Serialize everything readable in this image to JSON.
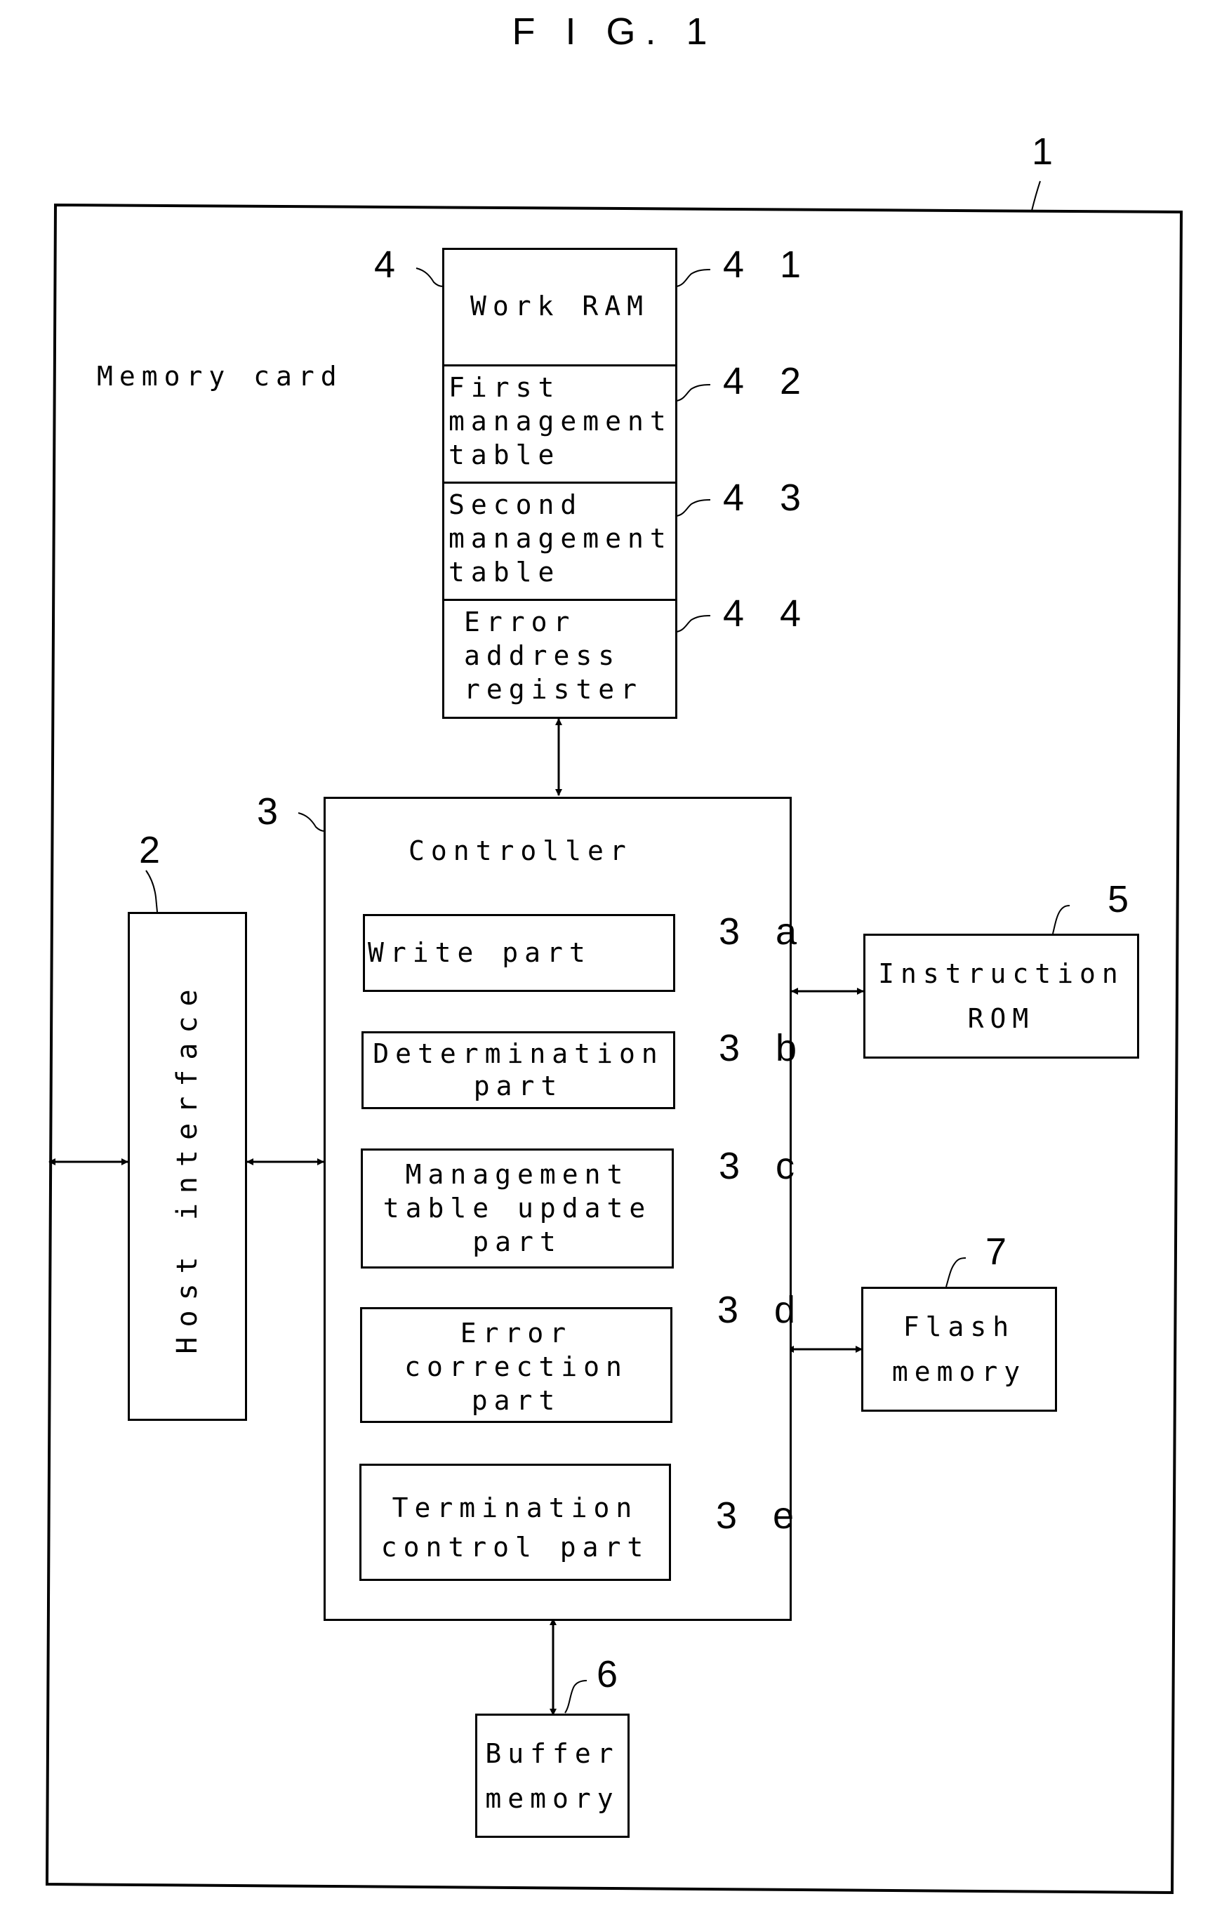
{
  "figure": {
    "title": "F I G. 1",
    "container": {
      "ref": "1",
      "label": "Memory card"
    },
    "work_ram": {
      "ref": "4",
      "sections": [
        {
          "ref": "4 1",
          "label": "Work RAM"
        },
        {
          "ref": "4 2",
          "label": "First\nmanagement\ntable"
        },
        {
          "ref": "4 3",
          "label": "Second\nmanagement\ntable"
        },
        {
          "ref": "4 4",
          "label": "Error\naddress\nregister"
        }
      ]
    },
    "controller": {
      "ref": "3",
      "label": "Controller",
      "parts": [
        {
          "ref": "3 a",
          "label": "Write part"
        },
        {
          "ref": "3 b",
          "label": "Determination\npart"
        },
        {
          "ref": "3 c",
          "label": "Management\ntable update\npart"
        },
        {
          "ref": "3 d",
          "label": "Error\ncorrection\npart"
        },
        {
          "ref": "3 e",
          "label": "Termination\ncontrol part"
        }
      ]
    },
    "host_interface": {
      "ref": "2",
      "label": "Host interface"
    },
    "instruction_rom": {
      "ref": "5",
      "label": "Instruction\nROM"
    },
    "buffer_memory": {
      "ref": "6",
      "label": "Buffer\nmemory"
    },
    "flash_memory": {
      "ref": "7",
      "label": "Flash\nmemory"
    }
  }
}
